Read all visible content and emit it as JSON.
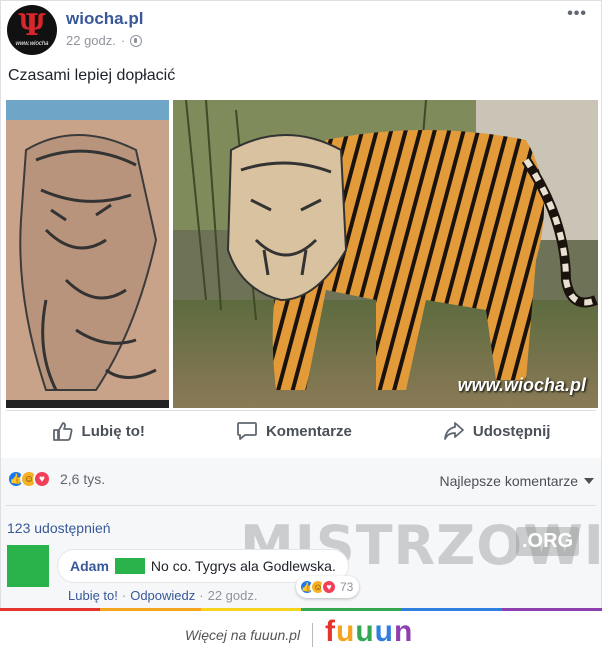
{
  "post": {
    "page_name": "wiocha.pl",
    "avatar_glyph": "Ψ",
    "avatar_text": "www.wiocha",
    "time": "22 godz.",
    "dot": "·",
    "more": "•••",
    "caption": "Czasami lepiej dopłacić",
    "watermark": "www.wiocha.pl"
  },
  "actions": {
    "like": "Lubię to!",
    "comment": "Komentarze",
    "share": "Udostępnij"
  },
  "reactions": {
    "count": "2,6 tys.",
    "best_comments": "Najlepsze komentarze",
    "shares": "123 udostępnień"
  },
  "comment": {
    "author": "Adam",
    "text": "No co. Tygrys ala Godlewska.",
    "like_link": "Lubię to!",
    "reply_link": "Odpowiedz",
    "time": "22 godz.",
    "reaction_count": "73"
  },
  "overlay": {
    "mistrzowie": "MISTRZOWIE",
    "org": ".ORG"
  },
  "footer": {
    "link_text": "Więcej na fuuun.pl",
    "logo": [
      "f",
      "u",
      "u",
      "u",
      "n"
    ],
    "logo_colors": [
      "#e4352c",
      "#f6a31e",
      "#33a852",
      "#2f7ee0",
      "#8e3fb0"
    ]
  },
  "icons": {
    "like": "thumbs-up-icon",
    "comment": "speech-bubble-icon",
    "share": "share-arrow-icon",
    "privacy": "globe-icon",
    "sort": "caret-down-icon"
  },
  "colors": {
    "link_blue": "#385898",
    "like_blue": "#1877f2",
    "love_red": "#f33e58",
    "haha_yellow": "#f7b125",
    "censor_green": "#2ab24b"
  }
}
